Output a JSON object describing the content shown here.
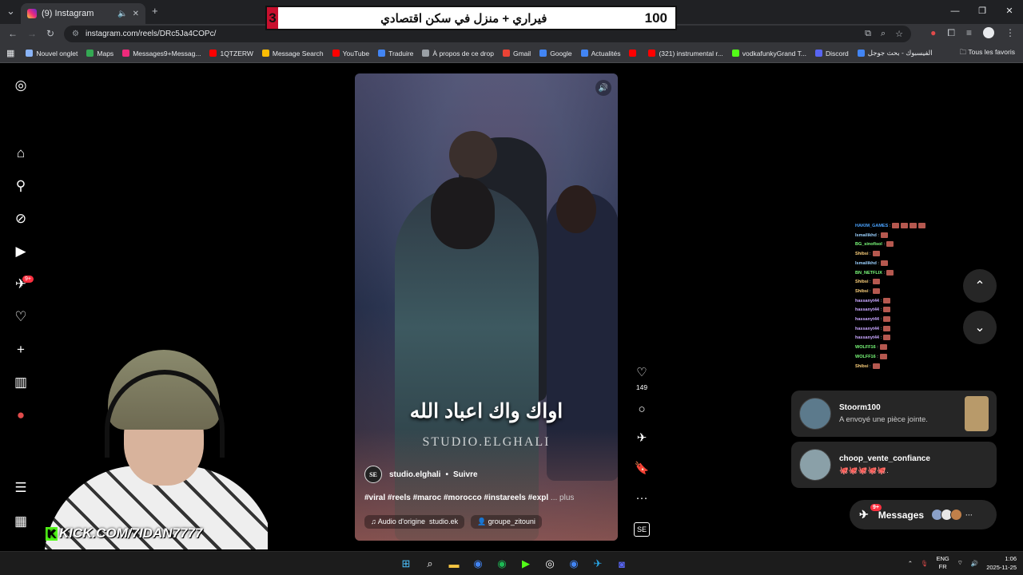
{
  "browser": {
    "tab_title": "(9) Instagram",
    "new_tab_icon": "plus-icon",
    "url": "instagram.com/reels/DRc5Ja4COPc/",
    "bookmarks": [
      {
        "label": "Nouvel onglet",
        "color": "#8ab4f8"
      },
      {
        "label": "Maps",
        "color": "#34a853"
      },
      {
        "label": "Messages9+Messag...",
        "color": "#ee2a7b"
      },
      {
        "label": "1QTZERW",
        "color": "#ff0000"
      },
      {
        "label": "Message Search",
        "color": "#fbbc04"
      },
      {
        "label": "YouTube",
        "color": "#ff0000"
      },
      {
        "label": "Traduire",
        "color": "#4285f4"
      },
      {
        "label": "À propos de ce drop",
        "color": "#9aa0a6"
      },
      {
        "label": "Gmail",
        "color": "#ea4335"
      },
      {
        "label": "Google",
        "color": "#4285f4"
      },
      {
        "label": "Actualités",
        "color": "#4285f4"
      },
      {
        "label": "",
        "color": "#ff0000"
      },
      {
        "label": "(321) instrumental r...",
        "color": "#ff0000"
      },
      {
        "label": "vodkafunkyGrand T...",
        "color": "#53fc18"
      },
      {
        "label": "Discord",
        "color": "#5865f2"
      },
      {
        "label": "الفيسبوك - بحث جوجل",
        "color": "#4285f4"
      }
    ],
    "all_bookmarks": "Tous les favoris"
  },
  "banner": {
    "left_number": "3",
    "label": "فيراري + منزل في سكن اقتصادي",
    "right_number": "100"
  },
  "sidebar": {
    "notifications_badge": "9+"
  },
  "reel": {
    "caption_arabic": "اواك واك اعباد الله",
    "watermark": "STUDIO.ELGHALI",
    "author_avatar": "SE",
    "author": "studio.elghali",
    "follow": "Suivre",
    "hashtags": "#viral #reels #maroc #morocco #instareels #expl",
    "more": "... plus",
    "audio": "Audio d'origine",
    "audio_author": "studio.ek",
    "collab": "groupe_zitouni",
    "likes": "149"
  },
  "chat": [
    {
      "name": "HAKIM_GAMES",
      "color": "#4aa3ff",
      "emotes": 4
    },
    {
      "name": "Ismailikhd",
      "color": "#9bd1ff",
      "emotes": 1
    },
    {
      "name": "BG_sinofisol",
      "color": "#7cff7c",
      "emotes": 1
    },
    {
      "name": "Shibsi",
      "color": "#ffd27c",
      "emotes": 1
    },
    {
      "name": "Ismailikhd",
      "color": "#9bd1ff",
      "emotes": 1
    },
    {
      "name": "BN_NETFLIX",
      "color": "#7cff7c",
      "emotes": 1
    },
    {
      "name": "Shibsi",
      "color": "#ffd27c",
      "emotes": 1
    },
    {
      "name": "Shibsi",
      "color": "#ffd27c",
      "emotes": 1
    },
    {
      "name": "hassanyt44",
      "color": "#c9a7ff",
      "emotes": 1
    },
    {
      "name": "hassanyt44",
      "color": "#c9a7ff",
      "emotes": 1
    },
    {
      "name": "hassanyt44",
      "color": "#c9a7ff",
      "emotes": 1
    },
    {
      "name": "hassanyt44",
      "color": "#c9a7ff",
      "emotes": 1
    },
    {
      "name": "hassanyt44",
      "color": "#c9a7ff",
      "emotes": 1
    },
    {
      "name": "WOLFF16",
      "color": "#7cff7c",
      "emotes": 1
    },
    {
      "name": "WOLFF16",
      "color": "#7cff7c",
      "emotes": 1
    },
    {
      "name": "Shibsi",
      "color": "#ffd27c",
      "emotes": 1
    }
  ],
  "notifications": [
    {
      "name": "Stoorm100",
      "text": "A envoyé une pièce jointe."
    },
    {
      "name": "choop_vente_confiance",
      "text": "🐙🐙🐙🐙🐙."
    }
  ],
  "messages": {
    "label": "Messages",
    "badge": "9+",
    "more": "···"
  },
  "webcam": {
    "kick_url": "KICK.COM/7IDAN7777",
    "kick_logo": "K"
  },
  "taskbar": {
    "lang_top": "ENG",
    "lang_bottom": "FR",
    "time": "1:06",
    "date": "2025-11-25"
  }
}
